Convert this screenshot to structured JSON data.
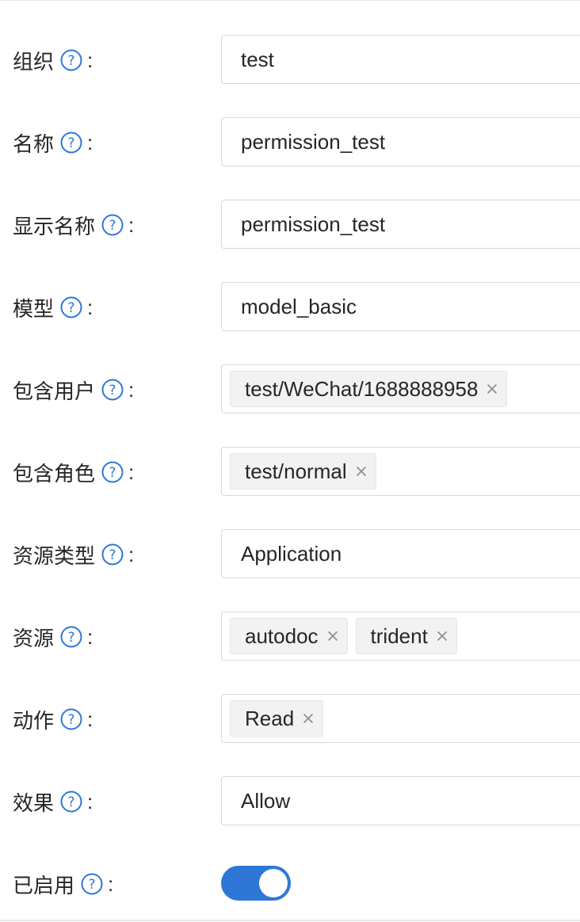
{
  "colors": {
    "accent": "#2f77d6",
    "border": "#d9d9d9",
    "tag_bg": "#f2f2f2",
    "text": "#262626"
  },
  "form": {
    "colon": ":",
    "fields": [
      {
        "label": "组织",
        "value": "test"
      },
      {
        "label": "名称",
        "value": "permission_test"
      },
      {
        "label": "显示名称",
        "value": "permission_test"
      },
      {
        "label": "模型",
        "value": "model_basic"
      },
      {
        "label": "包含用户",
        "tags": [
          "test/WeChat/1688888958"
        ]
      },
      {
        "label": "包含角色",
        "tags": [
          "test/normal"
        ]
      },
      {
        "label": "资源类型",
        "value": "Application"
      },
      {
        "label": "资源",
        "tags": [
          "autodoc",
          "trident"
        ]
      },
      {
        "label": "动作",
        "tags": [
          "Read"
        ]
      },
      {
        "label": "效果",
        "value": "Allow"
      },
      {
        "label": "已启用",
        "switch_on": true
      }
    ]
  },
  "icons": {
    "help": "question-circle-icon",
    "tag_close": "close-icon"
  }
}
